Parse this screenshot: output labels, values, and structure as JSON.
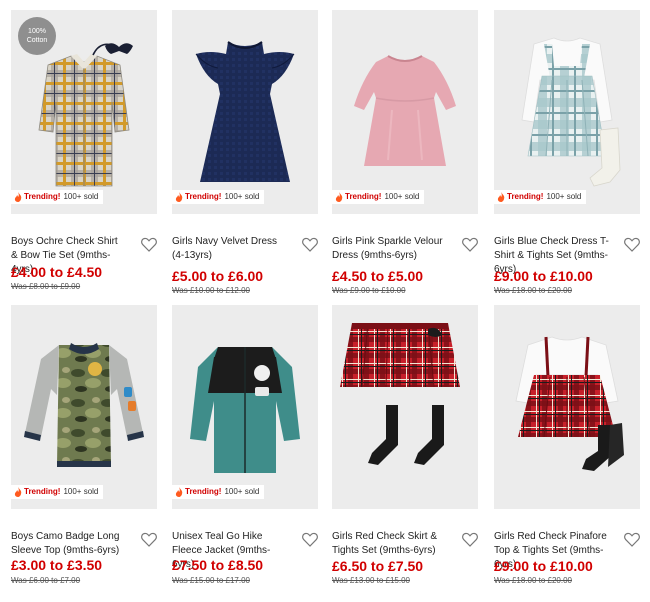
{
  "badges": {
    "trending": "Trending!",
    "sold": "100+ sold",
    "cotton_line1": "100%",
    "cotton_line2": "Cotton"
  },
  "colors": {
    "sale_red": "#d10000",
    "image_bg": "#ececec"
  },
  "products": [
    {
      "name": "Boys Ochre Check Shirt & Bow Tie Set (9mths-4yrs)",
      "price": "£4.00 to £4.50",
      "was": "Was £8.00 to £9.00",
      "trending": true,
      "cotton": true
    },
    {
      "name": "Girls Navy Velvet Dress (4-13yrs)",
      "price": "£5.00 to £6.00",
      "was": "Was £10.00 to £12.00",
      "trending": true,
      "cotton": false
    },
    {
      "name": "Girls Pink Sparkle Velour Dress (9mths-6yrs)",
      "price": "£4.50 to £5.00",
      "was": "Was £9.00 to £10.00",
      "trending": true,
      "cotton": false
    },
    {
      "name": "Girls Blue Check Dress T-Shirt & Tights Set (9mths-6yrs)",
      "price": "£9.00 to £10.00",
      "was": "Was £18.00 to £20.00",
      "trending": true,
      "cotton": false
    },
    {
      "name": "Boys Camo Badge Long Sleeve Top (9mths-6yrs)",
      "price": "£3.00 to £3.50",
      "was": "Was £6.00 to £7.00",
      "trending": true,
      "cotton": false
    },
    {
      "name": "Unisex Teal Go Hike Fleece Jacket (9mths-6yrs)",
      "price": "£7.50 to £8.50",
      "was": "Was £15.00 to £17.00",
      "trending": true,
      "cotton": false
    },
    {
      "name": "Girls Red Check Skirt & Tights Set (9mths-6yrs)",
      "price": "£6.50 to £7.50",
      "was": "Was £13.00 to £15.00",
      "trending": false,
      "cotton": false
    },
    {
      "name": "Girls Red Check Pinafore Top & Tights Set (9mths-6yrs)",
      "price": "£9.00 to £10.00",
      "was": "Was £18.00 to £20.00",
      "trending": false,
      "cotton": false
    }
  ]
}
